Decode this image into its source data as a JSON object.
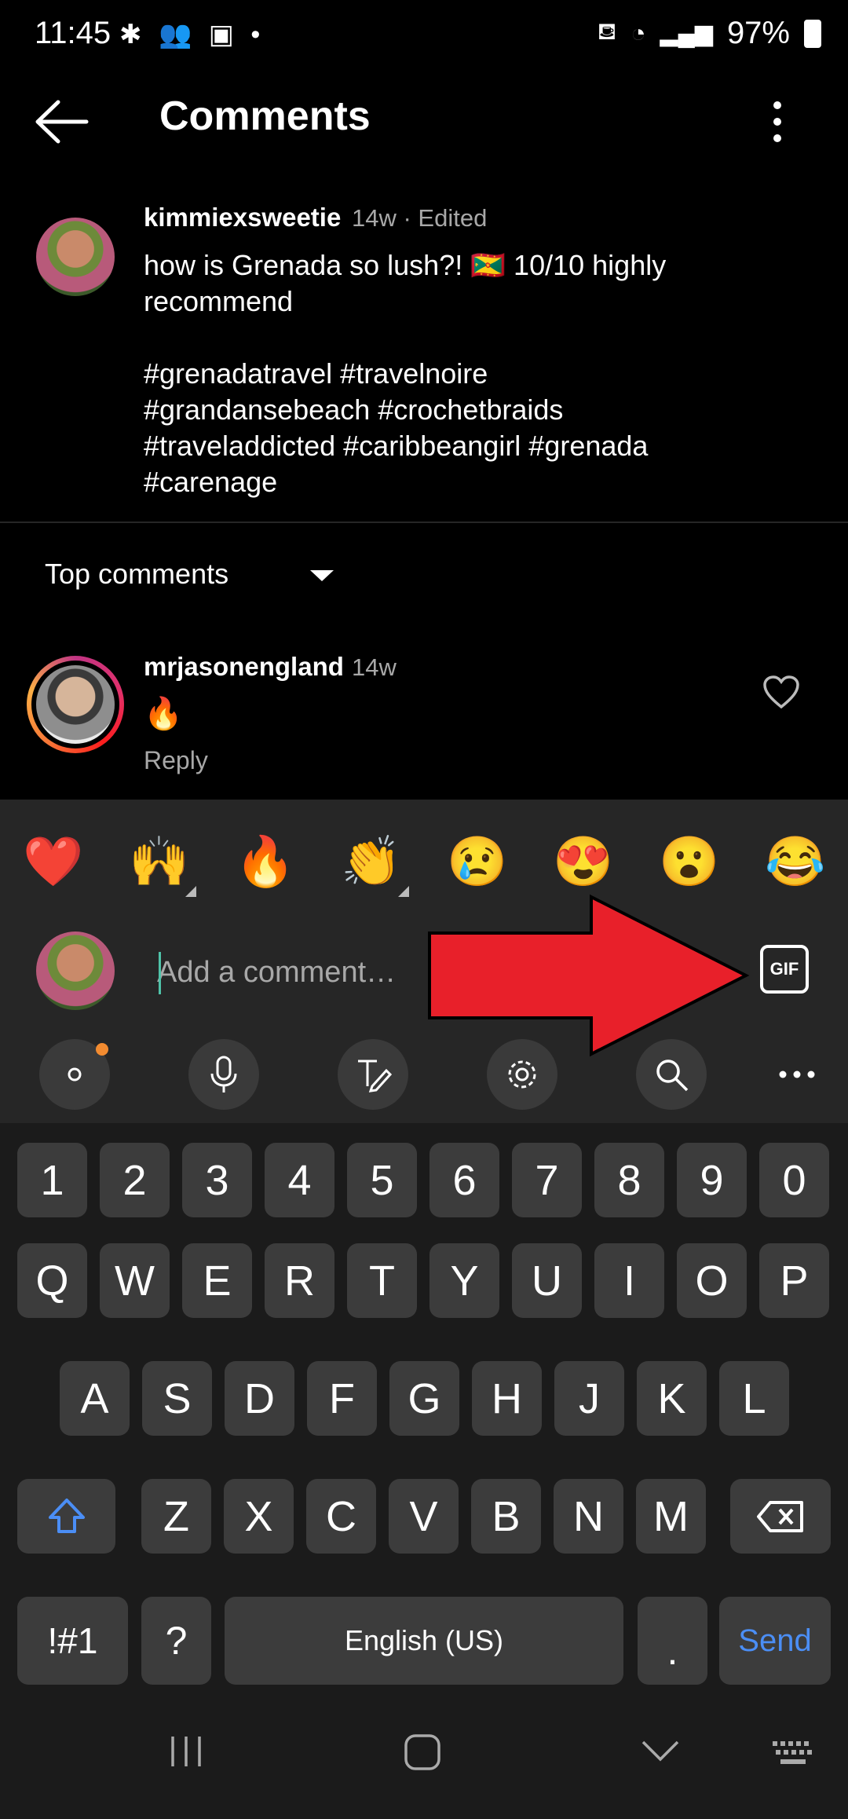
{
  "status_bar": {
    "time": "11:45",
    "notification_icons": [
      "slack-icon",
      "group-icon",
      "video-call-icon",
      "dot-icon"
    ],
    "battery": "97%"
  },
  "header": {
    "title": "Comments"
  },
  "caption": {
    "username": "kimmiexsweetie",
    "meta": "14w · Edited",
    "text": "how is Grenada so lush?! 🇬🇩 10/10 highly\nrecommend\n\n#grenadatravel #travelnoire\n#grandansebeach #crochetbraids\n#traveladdicted #caribbeangirl  #grenada\n#carenage"
  },
  "sort": {
    "label": "Top comments"
  },
  "comments": [
    {
      "username": "mrjasonengland",
      "time": "14w",
      "text": "🔥",
      "reply": "Reply"
    }
  ],
  "emoji_bar": [
    "❤️",
    "🙌",
    "🔥",
    "👏",
    "😢",
    "😍",
    "😮",
    "😂"
  ],
  "input": {
    "placeholder": "Add a comment…",
    "gif_label": "GIF"
  },
  "keyboard": {
    "number_row": [
      "1",
      "2",
      "3",
      "4",
      "5",
      "6",
      "7",
      "8",
      "9",
      "0"
    ],
    "row1": [
      "Q",
      "W",
      "E",
      "R",
      "T",
      "Y",
      "U",
      "I",
      "O",
      "P"
    ],
    "row2": [
      "A",
      "S",
      "D",
      "F",
      "G",
      "H",
      "J",
      "K",
      "L"
    ],
    "row3": [
      "Z",
      "X",
      "C",
      "V",
      "B",
      "N",
      "M"
    ],
    "symbols": "!#1",
    "question": "?",
    "space": "English (US)",
    "period": ".",
    "send": "Send"
  },
  "colors": {
    "send_blue": "#4b8ef5",
    "shift_blue": "#4b8ef5",
    "arrow_red": "#e8202a",
    "ring_accent": "#e1306c"
  }
}
